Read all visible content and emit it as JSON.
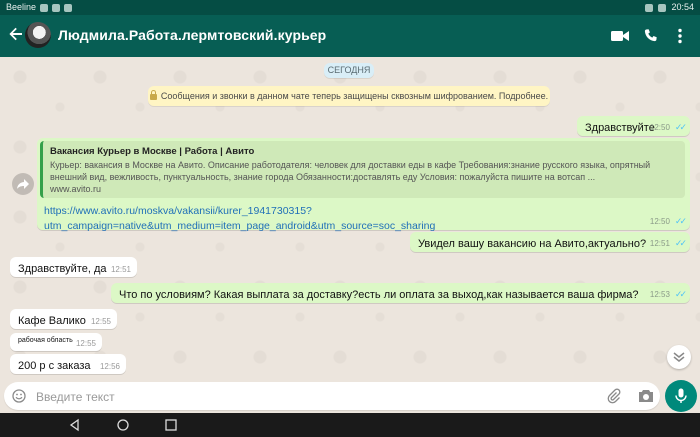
{
  "status": {
    "carrier": "Beeline",
    "time": "20:54"
  },
  "header": {
    "chat_title": "Людмила.Работа.лермтовский.курьер"
  },
  "chat": {
    "date_chip": "СЕГОДНЯ",
    "encryption_notice": "Сообщения и звонки в данном чате теперь защищены сквозным шифрованием. Подробнее.",
    "messages": [
      {
        "dir": "out",
        "text": "Здравствуйте",
        "time": "12:50",
        "ticks": "✓✓"
      },
      {
        "dir": "out",
        "preview_title": "Вакансия Курьер в Москве | Работа | Авито",
        "preview_desc": "Курьер: вакансия в Москве на Авито. Описание работодателя: человек для доставки еды в кафе Требования:знание русского языка, опрятный внешний вид, вежливость, пунктуальность, знание города Обязанности:доставлять еду Условия: пожалуйста пишите на вотсап ...",
        "preview_domain": "www.avito.ru",
        "text": "https://www.avito.ru/moskva/vakansii/kurer_1941730315?utm_campaign=native&utm_medium=item_page_android&utm_source=soc_sharing",
        "time": "12:50",
        "ticks": "✓✓"
      },
      {
        "dir": "out",
        "text": "Увидел вашу вакансию на Авито,актуально?",
        "time": "12:51",
        "ticks": "✓✓"
      },
      {
        "dir": "in",
        "text": "Здравствуйте, да",
        "time": "12:51"
      },
      {
        "dir": "out",
        "text": "Что по условиям? Какая выплата за доставку?есть ли оплата за выход,как называется ваша фирма?",
        "time": "12:53",
        "ticks": "✓✓"
      },
      {
        "dir": "in",
        "text": "Кафе Валико",
        "time": "12:55"
      },
      {
        "dir": "in",
        "text": "рабочая область",
        "time": "12:55"
      },
      {
        "dir": "in",
        "text": "200 р с заказа",
        "time": "12:56"
      }
    ]
  },
  "composer": {
    "placeholder": "Введите текст"
  },
  "icons": {
    "back": "arrow-left-icon",
    "video": "video-call-icon",
    "call": "phone-icon",
    "menu": "more-vert-icon",
    "forward": "forward-icon",
    "scroll": "chevron-down-icon",
    "emoji": "emoji-icon",
    "attach": "paperclip-icon",
    "camera": "camera-icon",
    "mic": "mic-icon"
  },
  "colors": {
    "appbar": "#075e54",
    "outgoing_bubble": "#dcf8c6",
    "incoming_bubble": "#ffffff",
    "read_ticks": "#4fc3f7",
    "mic_button": "#00897b"
  }
}
